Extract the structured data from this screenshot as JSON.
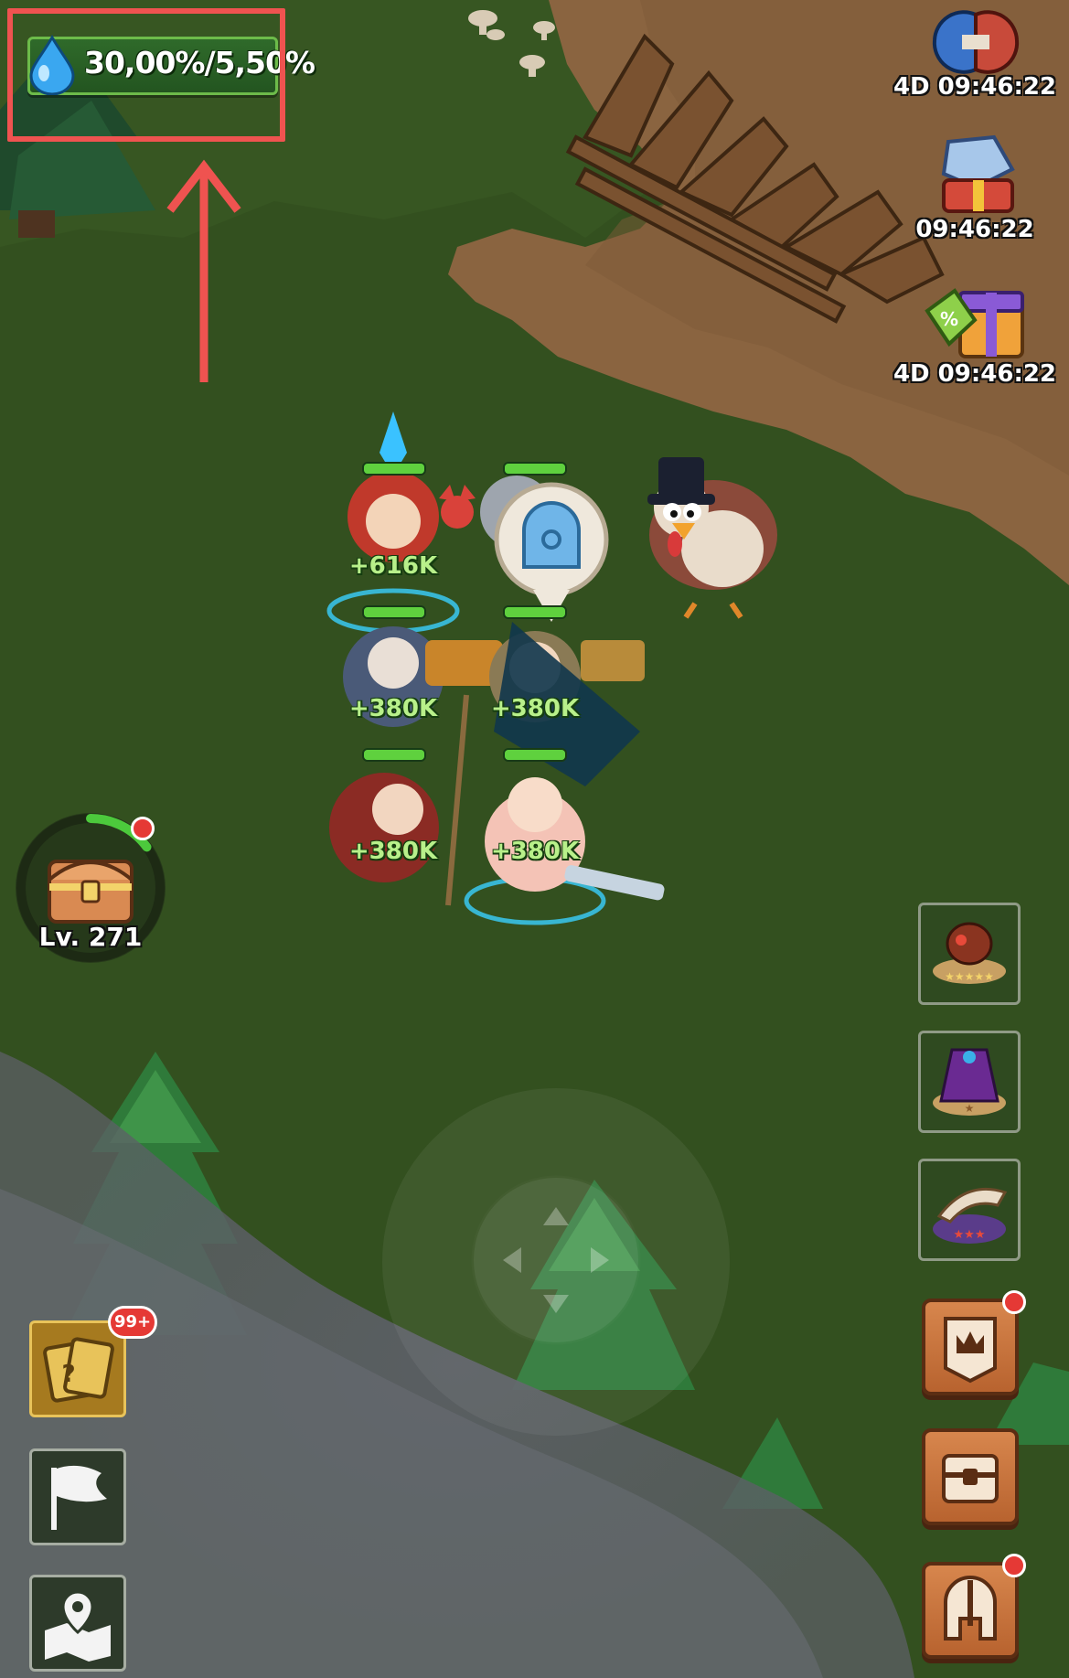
{
  "hud": {
    "resource_rate": "30,00%/5,50%",
    "resource_icon": "water-drop-icon"
  },
  "events": [
    {
      "icon": "warriors-clash-icon",
      "timer": "4D 09:46:22"
    },
    {
      "icon": "crystal-gift-icon",
      "timer": "09:46:22"
    },
    {
      "icon": "discount-gift-icon",
      "timer": "4D 09:46:22"
    }
  ],
  "party": {
    "powers": [
      "+616K",
      "+380K",
      "+380K",
      "+380K",
      "+380K"
    ],
    "hp": [
      1,
      1,
      1,
      1,
      1,
      1
    ],
    "portal_icon": "portal-gate-icon"
  },
  "chest": {
    "level_label": "Lv. 271",
    "progress": 0.15
  },
  "left_menu": {
    "cards_badge": "99+",
    "cards_icon": "mystery-cards-icon",
    "flag_icon": "flag-icon",
    "map_icon": "map-pin-icon"
  },
  "right_slots": [
    {
      "icon": "beetle-relic-icon",
      "stars": 5
    },
    {
      "icon": "purple-cloak-icon",
      "stars": 1
    },
    {
      "icon": "horn-icon",
      "stars": 3
    }
  ],
  "right_menu": [
    {
      "icon": "crown-banner-icon",
      "notify": true
    },
    {
      "icon": "treasure-chest-icon",
      "notify": false
    },
    {
      "icon": "spartan-helmet-icon",
      "notify": true
    }
  ],
  "colors": {
    "grass": "#33501f",
    "dirt": "#8a6440",
    "highlight": "#ef5350",
    "power_text": "#b8f08a"
  }
}
